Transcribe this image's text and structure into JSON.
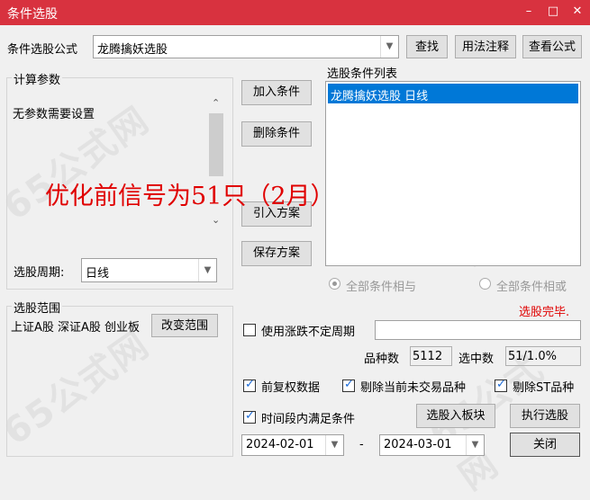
{
  "window": {
    "title": "条件选股",
    "minimize": "–",
    "maximize": "□",
    "close": "✕"
  },
  "formula": {
    "label": "条件选股公式",
    "value": "龙腾擒妖选股",
    "find": "查找",
    "usage": "用法注释",
    "view": "查看公式"
  },
  "params": {
    "legend": "计算参数",
    "text": "无参数需要设置"
  },
  "buttons": {
    "add": "加入条件",
    "delete": "删除条件",
    "import": "引入方案",
    "save": "保存方案"
  },
  "condition_list": {
    "label": "选股条件列表",
    "items": [
      "龙腾擒妖选股  日线"
    ]
  },
  "overlay_text": "优化前信号为51只（2月）",
  "period": {
    "label": "选股周期:",
    "value": "日线"
  },
  "logic": {
    "and_label": "全部条件相与",
    "or_label": "全部条件相或"
  },
  "status": "选股完毕.",
  "range": {
    "legend": "选股范围",
    "text": "上证A股 深证A股 创业板",
    "change": "改变范围"
  },
  "uncertain_period": {
    "label": "使用涨跌不定周期",
    "checked": false
  },
  "stats": {
    "count_label": "品种数",
    "count": "5112",
    "selected_label": "选中数",
    "selected": "51/1.0%"
  },
  "options": {
    "adjust": "前复权数据",
    "exclude_untraded": "剔除当前未交易品种",
    "exclude_st": "剔除ST品种",
    "time_range": "时间段内满足条件"
  },
  "actions": {
    "to_block": "选股入板块",
    "execute": "执行选股",
    "close": "关闭"
  },
  "dates": {
    "start": "2024-02-01",
    "separator": "-",
    "end": "2024-03-01"
  },
  "watermark": "65公式网",
  "colors": {
    "titlebar": "#d8323f",
    "selection": "#0078d7",
    "overlay": "#e00000",
    "status": "#e00000"
  }
}
